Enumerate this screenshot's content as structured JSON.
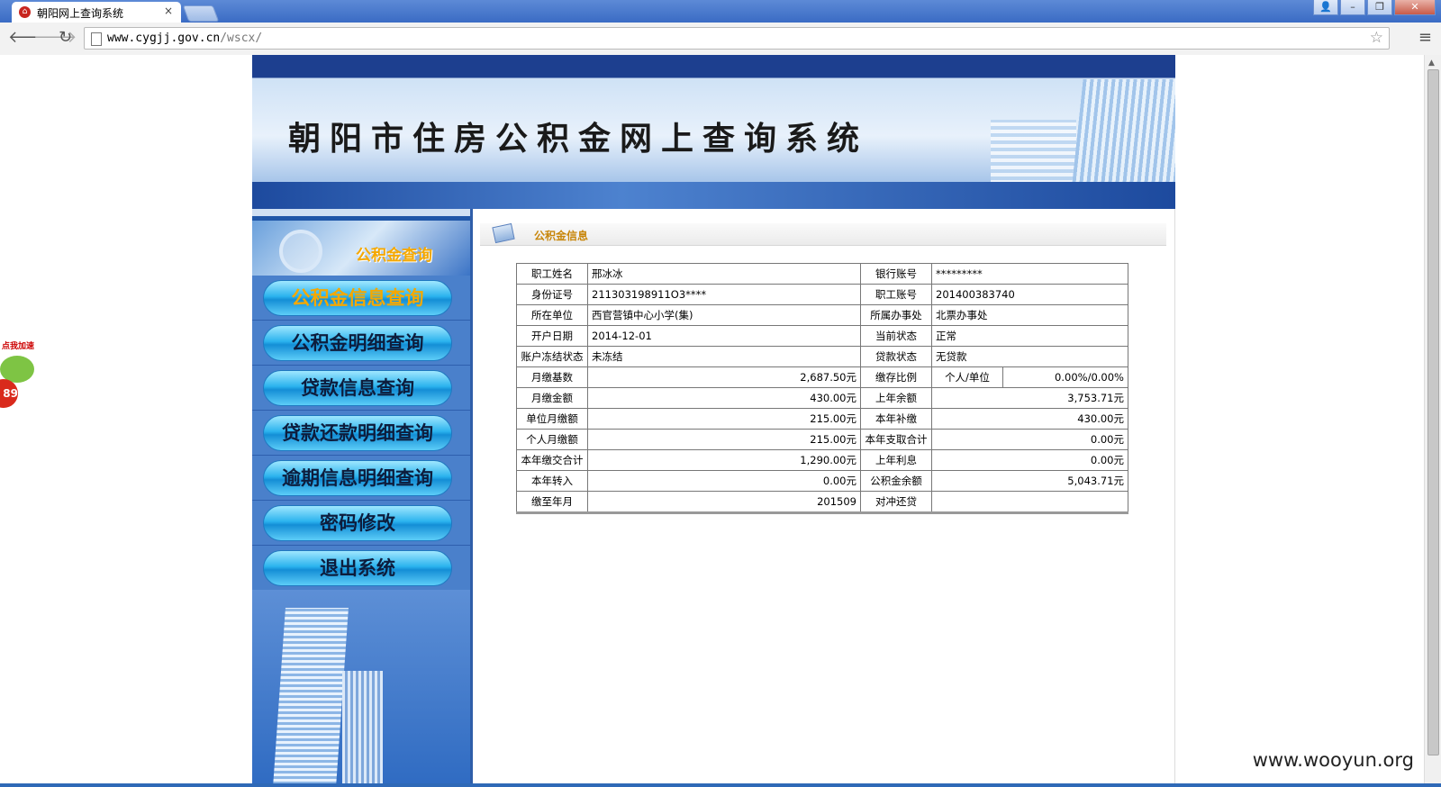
{
  "browser": {
    "tab_title": "朝阳网上查询系统",
    "tab_close": "×",
    "url_host": "www.cygjj.gov.cn",
    "url_path": "/wscx/",
    "window_buttons": [
      "👤",
      "–",
      "❐",
      "✕"
    ]
  },
  "banner": {
    "title": "朝阳市住房公积金网上查询系统"
  },
  "sidebar": {
    "header": "公积金查询",
    "items": [
      {
        "label": "公积金信息查询",
        "active": true
      },
      {
        "label": "公积金明细查询",
        "active": false
      },
      {
        "label": "贷款信息查询",
        "active": false
      },
      {
        "label": "贷款还款明细查询",
        "active": false
      },
      {
        "label": "逾期信息明细查询",
        "active": false
      },
      {
        "label": "密码修改",
        "active": false
      },
      {
        "label": "退出系统",
        "active": false
      }
    ]
  },
  "section": {
    "title": "公积金信息"
  },
  "info": {
    "rows": [
      {
        "l1": "职工姓名",
        "v1": "邢冰冰",
        "l2": "银行账号",
        "v2": "*********"
      },
      {
        "l1": "身份证号",
        "v1": "211303198911O3****",
        "l2": "职工账号",
        "v2": "201400383740"
      },
      {
        "l1": "所在单位",
        "v1": "西官营镇中心小学(集)",
        "l2": "所属办事处",
        "v2": "北票办事处"
      },
      {
        "l1": "开户日期",
        "v1": "2014-12-01",
        "l2": "当前状态",
        "v2": "正常"
      },
      {
        "l1": "账户冻结状态",
        "v1": "未冻结",
        "l2": "贷款状态",
        "v2": "无贷款"
      },
      {
        "l1": "月缴基数",
        "v1": "2,687.50元",
        "l2": "缴存比例",
        "v2_sub": "个人/单位",
        "v2": "0.00%/0.00%"
      },
      {
        "l1": "月缴金额",
        "v1": "430.00元",
        "l2": "上年余额",
        "v2": "3,753.71元"
      },
      {
        "l1": "单位月缴额",
        "v1": "215.00元",
        "l2": "本年补缴",
        "v2": "430.00元"
      },
      {
        "l1": "个人月缴额",
        "v1": "215.00元",
        "l2": "本年支取合计",
        "v2": "0.00元"
      },
      {
        "l1": "本年缴交合计",
        "v1": "1,290.00元",
        "l2": "上年利息",
        "v2": "0.00元"
      },
      {
        "l1": "本年转入",
        "v1": "0.00元",
        "l2": "公积金余额",
        "v2": "5,043.71元"
      },
      {
        "l1": "缴至年月",
        "v1": "201509",
        "l2": "对冲还贷",
        "v2": ""
      }
    ]
  },
  "float_widget": {
    "label": "点我加速",
    "count": "89"
  },
  "watermark": "www.wooyun.org",
  "colors": {
    "banner_blue": "#1d3f8f",
    "sidebar_blue": "#2f6bc2",
    "active_menu_text": "#f5a800",
    "section_title": "#c8860a"
  }
}
